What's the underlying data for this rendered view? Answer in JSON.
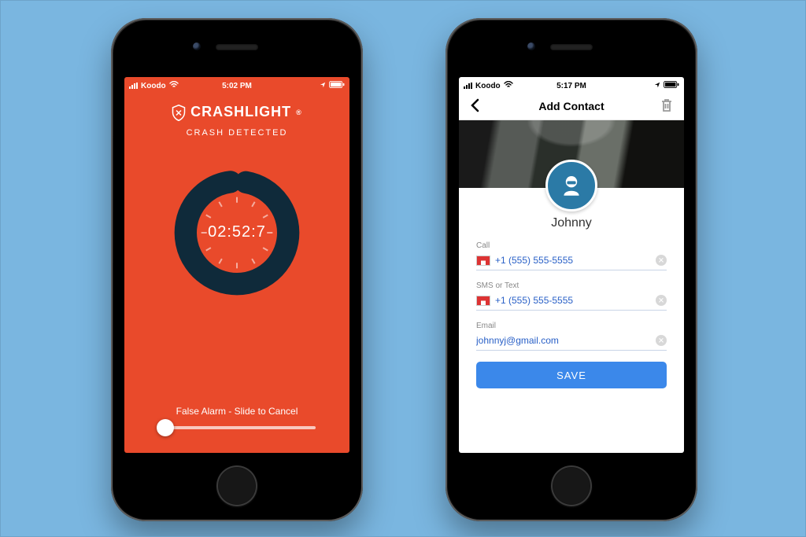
{
  "phone1": {
    "status": {
      "carrier": "Koodo",
      "time": "5:02 PM"
    },
    "app_name": "CRASHLIGHT",
    "subtitle": "CRASH DETECTED",
    "timer": "02:52:7",
    "cancel_text": "False Alarm - Slide to Cancel"
  },
  "phone2": {
    "status": {
      "carrier": "Koodo",
      "time": "5:17 PM"
    },
    "nav_title": "Add Contact",
    "contact_name": "Johnny",
    "fields": {
      "call": {
        "label": "Call",
        "value": "+1 (555) 555-5555",
        "flag": "ca"
      },
      "sms": {
        "label": "SMS or Text",
        "value": "+1 (555) 555-5555",
        "flag": "ca"
      },
      "email": {
        "label": "Email",
        "value": "johnnyj@gmail.com"
      }
    },
    "save_label": "SAVE"
  }
}
